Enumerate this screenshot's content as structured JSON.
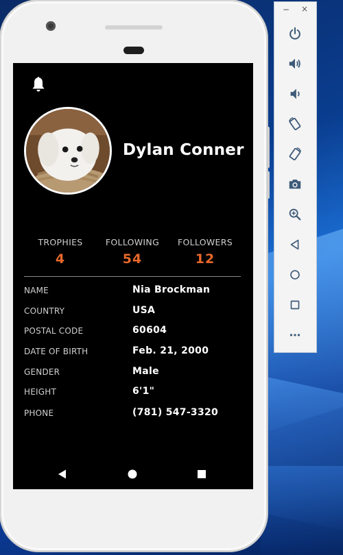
{
  "toolbar": {
    "minimize": "−",
    "close": "×",
    "buttons": [
      "power-icon",
      "volume-up-icon",
      "volume-down-icon",
      "rotate-left-icon",
      "rotate-right-icon",
      "camera-icon",
      "zoom-in-icon",
      "back-icon",
      "home-icon",
      "overview-icon",
      "more-icon"
    ]
  },
  "profile": {
    "name": "Dylan Conner",
    "avatar": "puppy-photo"
  },
  "stats": [
    {
      "label": "TROPHIES",
      "value": "4"
    },
    {
      "label": "FOLLOWING",
      "value": "54"
    },
    {
      "label": "FOLLOWERS",
      "value": "12"
    }
  ],
  "details": [
    {
      "label": "NAME",
      "value": "Nia Brockman"
    },
    {
      "label": "COUNTRY",
      "value": "USA"
    },
    {
      "label": "POSTAL CODE",
      "value": "60604"
    },
    {
      "label": "DATE OF BIRTH",
      "value": "Feb. 21, 2000"
    },
    {
      "label": "GENDER",
      "value": "Male"
    },
    {
      "label": "HEIGHT",
      "value": "6'1\""
    },
    {
      "label": "PHONE",
      "value": "(781) 547-3320"
    }
  ],
  "colors": {
    "accent": "#e8682a",
    "screen_bg": "#000000",
    "phone_body": "#f1f1f1"
  }
}
